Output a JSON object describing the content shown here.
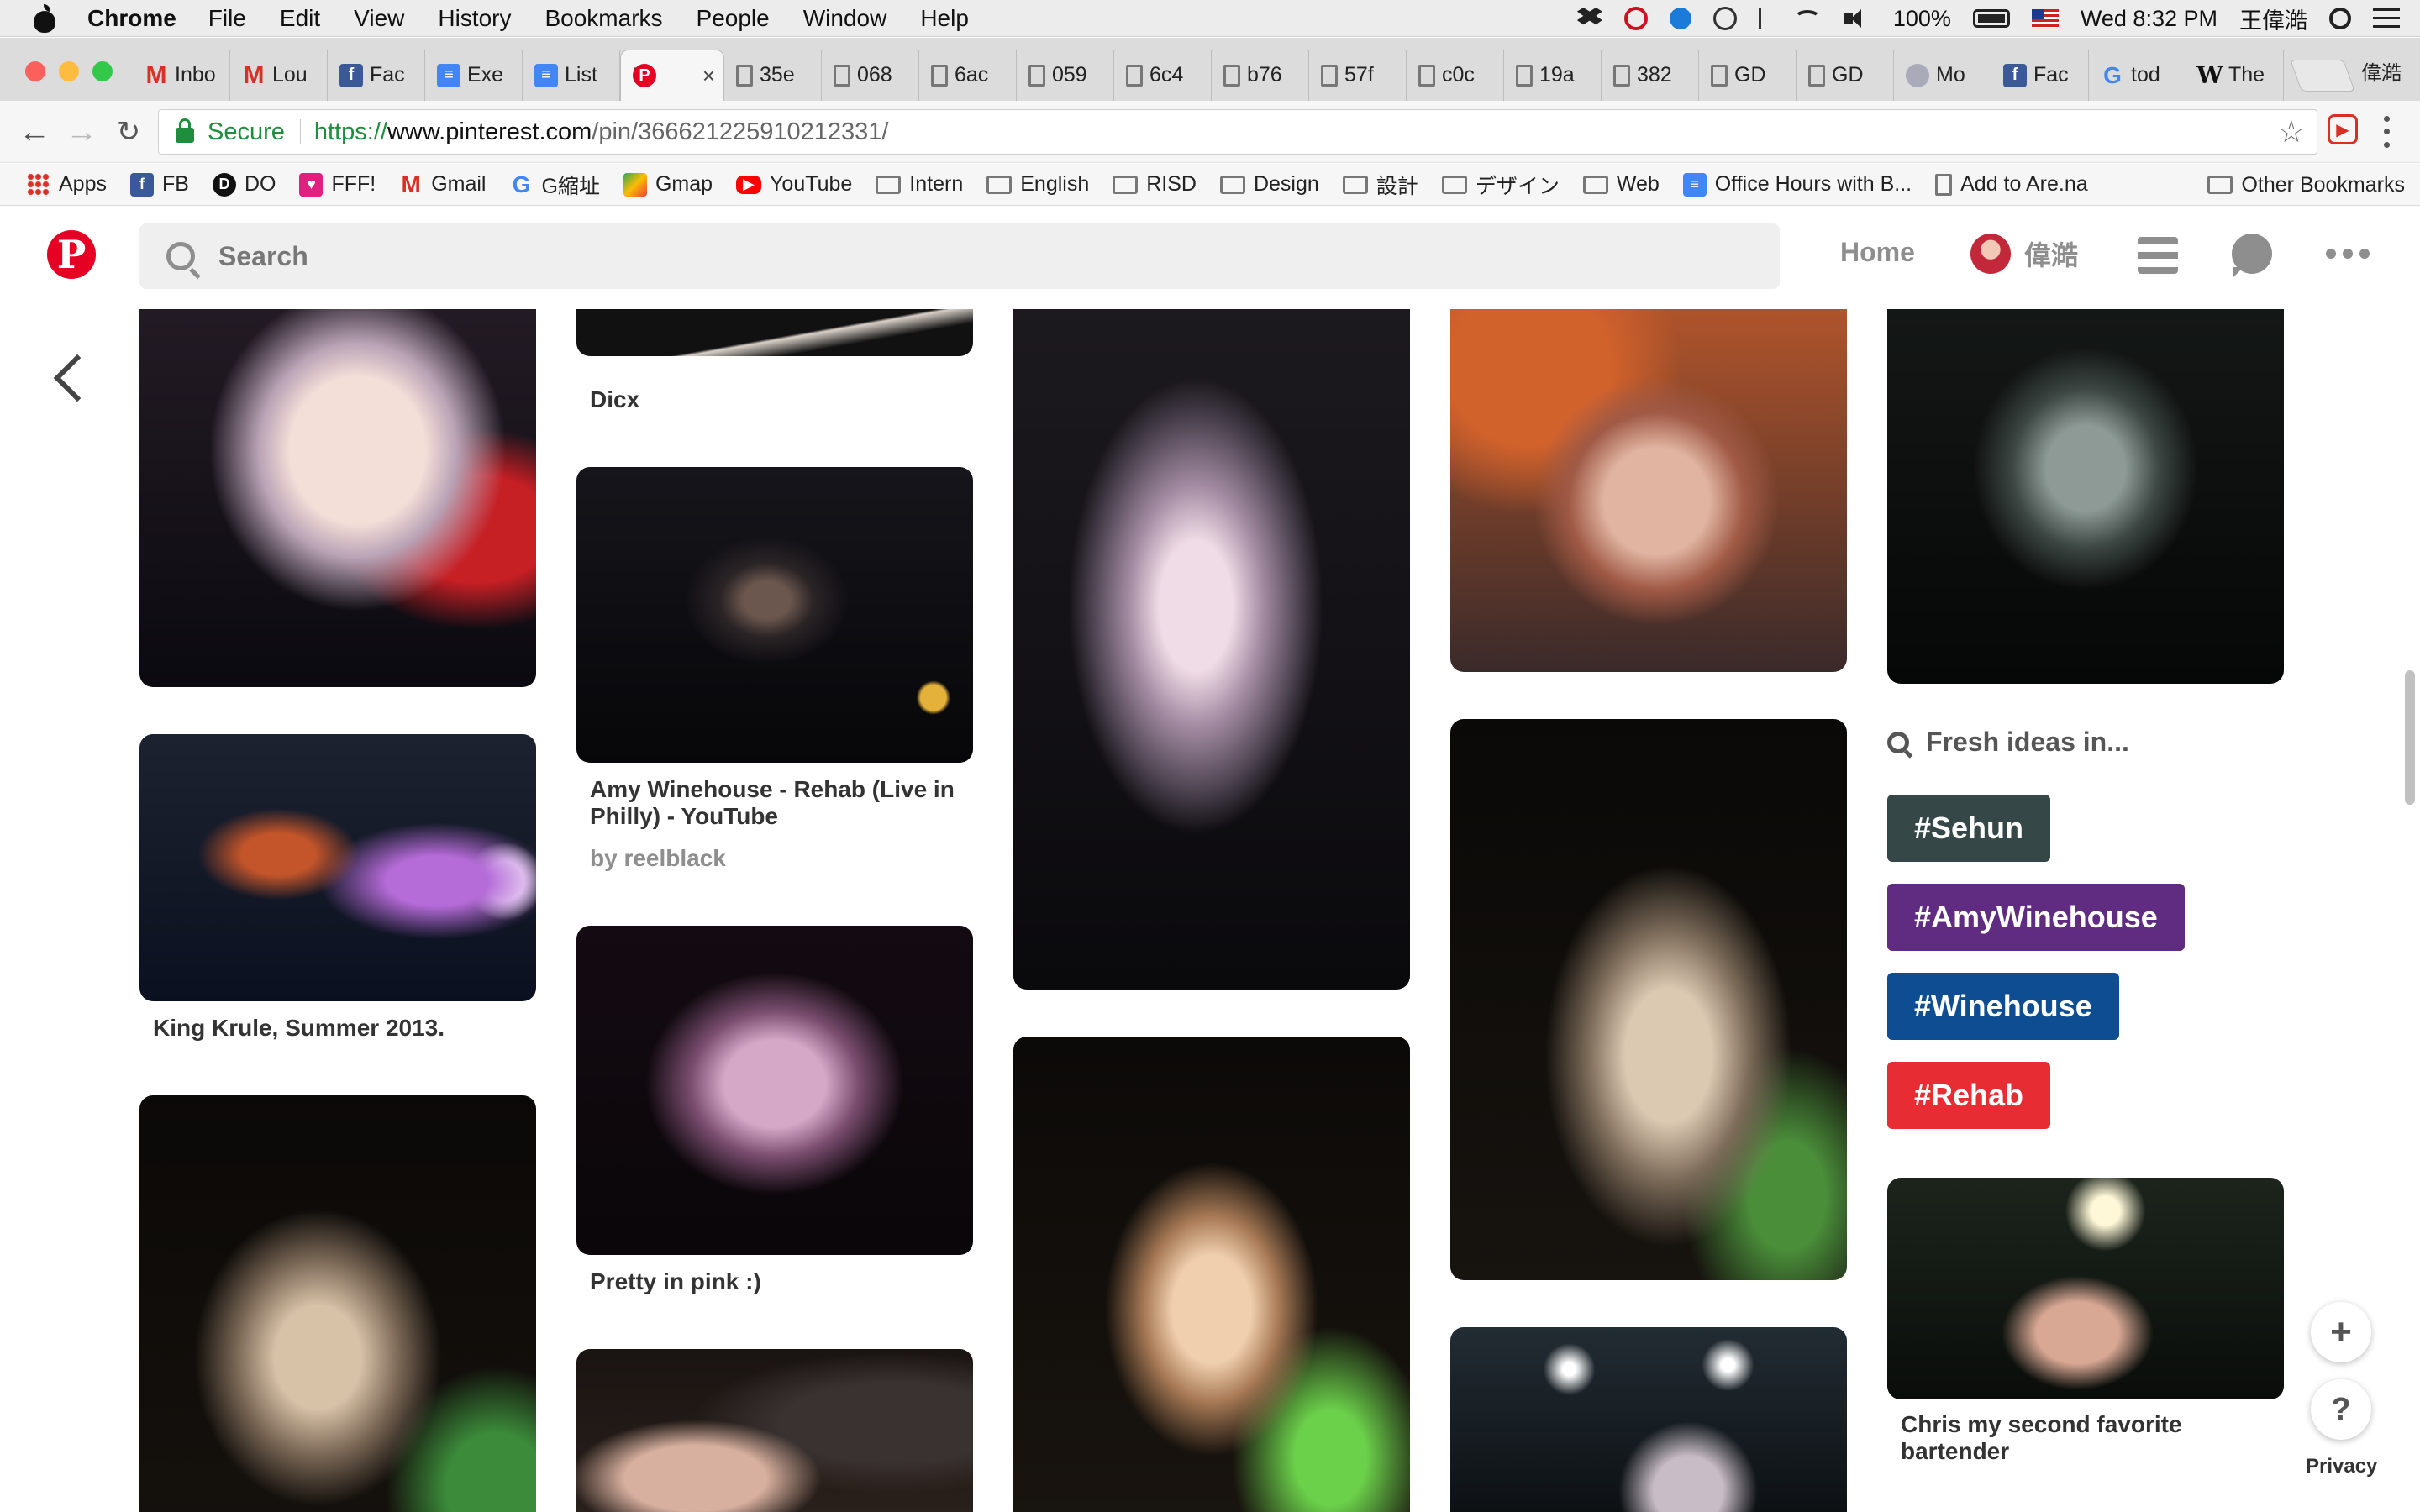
{
  "menubar": {
    "app": "Chrome",
    "menus": [
      "File",
      "Edit",
      "View",
      "History",
      "Bookmarks",
      "People",
      "Window",
      "Help"
    ],
    "battery": "100%",
    "datetime": "Wed 8:32 PM",
    "user": "王偉澔"
  },
  "tabs": [
    {
      "favicon": "gmail-icon",
      "label": "Inbo"
    },
    {
      "favicon": "gmail-icon",
      "label": "Lou"
    },
    {
      "favicon": "facebook-icon",
      "label": "Fac"
    },
    {
      "favicon": "google-docs-icon",
      "label": "Exe"
    },
    {
      "favicon": "google-docs-icon",
      "label": "List"
    },
    {
      "favicon": "pinterest-icon",
      "label": "P",
      "active": true
    },
    {
      "favicon": "file-icon",
      "label": "35e"
    },
    {
      "favicon": "file-icon",
      "label": "068"
    },
    {
      "favicon": "file-icon",
      "label": "6ac"
    },
    {
      "favicon": "file-icon",
      "label": "059"
    },
    {
      "favicon": "file-icon",
      "label": "6c4"
    },
    {
      "favicon": "file-icon",
      "label": "b76"
    },
    {
      "favicon": "file-icon",
      "label": "57f"
    },
    {
      "favicon": "file-icon",
      "label": "c0c"
    },
    {
      "favicon": "file-icon",
      "label": "19a"
    },
    {
      "favicon": "file-icon",
      "label": "382"
    },
    {
      "favicon": "file-icon",
      "label": "GD"
    },
    {
      "favicon": "file-icon",
      "label": "GD"
    },
    {
      "favicon": "moma-icon",
      "label": "Mo"
    },
    {
      "favicon": "facebook-icon",
      "label": "Fac"
    },
    {
      "favicon": "google-icon",
      "label": "tod"
    },
    {
      "favicon": "wikipedia-icon",
      "label": "The"
    }
  ],
  "profile_name": "偉澔",
  "toolbar": {
    "secure_label": "Secure",
    "url_scheme": "https://",
    "url_host": "www.pinterest.com",
    "url_path": "/pin/366621225910212331/"
  },
  "bookmarks": [
    {
      "icon": "apps-grid-icon",
      "label": "Apps"
    },
    {
      "icon": "facebook-icon",
      "label": "FB"
    },
    {
      "icon": "digitalocean-icon",
      "label": "DO"
    },
    {
      "icon": "heart-icon",
      "label": "FFF!"
    },
    {
      "icon": "gmail-icon",
      "label": "Gmail"
    },
    {
      "icon": "google-icon",
      "label": "G縮址"
    },
    {
      "icon": "google-maps-icon",
      "label": "Gmap"
    },
    {
      "icon": "youtube-icon",
      "label": "YouTube"
    },
    {
      "icon": "folder-icon",
      "label": "Intern"
    },
    {
      "icon": "folder-icon",
      "label": "English"
    },
    {
      "icon": "folder-icon",
      "label": "RISD"
    },
    {
      "icon": "folder-icon",
      "label": "Design"
    },
    {
      "icon": "folder-icon",
      "label": "設計"
    },
    {
      "icon": "folder-icon",
      "label": "デザイン"
    },
    {
      "icon": "folder-icon",
      "label": "Web"
    },
    {
      "icon": "google-docs-icon",
      "label": "Office Hours with B..."
    },
    {
      "icon": "file-icon",
      "label": "Add to Are.na"
    }
  ],
  "other_bookmarks": "Other Bookmarks",
  "pinterest": {
    "search_placeholder": "Search",
    "home": "Home",
    "username": "偉澔"
  },
  "pins": {
    "krule_neck": {
      "title": ""
    },
    "dicx": {
      "title": "Dicx"
    },
    "amy": {
      "title": "Amy Winehouse - Rehab (Live in Philly) - YouTube",
      "by": "by reelblack"
    },
    "pink": {
      "title": "Pretty in pink :)"
    },
    "krule_stage": {
      "title": "King Krule, Summer 2013."
    },
    "bartender": {
      "title": "Chris my second favorite bartender"
    }
  },
  "fresh_ideas": {
    "label": "Fresh ideas in...",
    "tags": [
      {
        "label": "#Sehun",
        "color": "#364747"
      },
      {
        "label": "#AmyWinehouse",
        "color": "#5f2c82"
      },
      {
        "label": "#Winehouse",
        "color": "#0e4d92"
      },
      {
        "label": "#Rehab",
        "color": "#e82c34"
      }
    ]
  },
  "fab": {
    "plus": "+",
    "help": "?",
    "privacy": "Privacy"
  }
}
